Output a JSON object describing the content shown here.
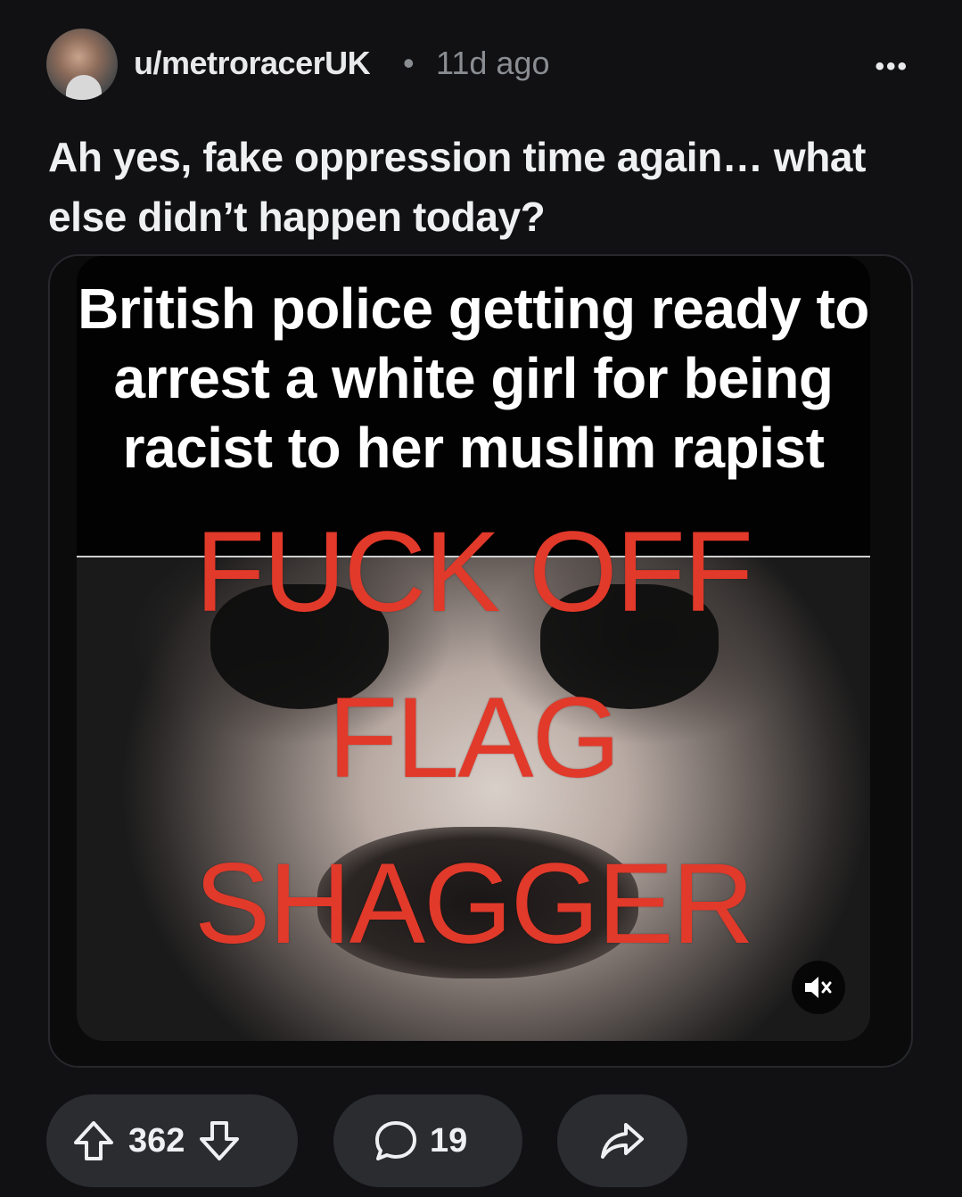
{
  "post": {
    "author": "u/metroracerUK",
    "separator": "•",
    "time": "11d ago",
    "title": "Ah yes, fake oppression time again… what else didn’t happen today?",
    "more_icon": "more-options-icon"
  },
  "media": {
    "caption": "British police getting ready to arrest a white girl for being racist to her muslim rapist",
    "overlay_lines": [
      "FUCK OFF",
      "FLAG",
      "SHAGGER"
    ],
    "mute_icon": "muted-speaker-icon"
  },
  "actions": {
    "upvote_icon": "upvote-arrow-icon",
    "vote_count": "362",
    "downvote_icon": "downvote-arrow-icon",
    "comment_icon": "comment-bubble-icon",
    "comment_count": "19",
    "share_icon": "share-arrow-icon"
  },
  "colors": {
    "background": "#111114",
    "pill": "#2a2c30",
    "overlay_red": "#e1392a",
    "muted_text": "#8a8d91"
  }
}
